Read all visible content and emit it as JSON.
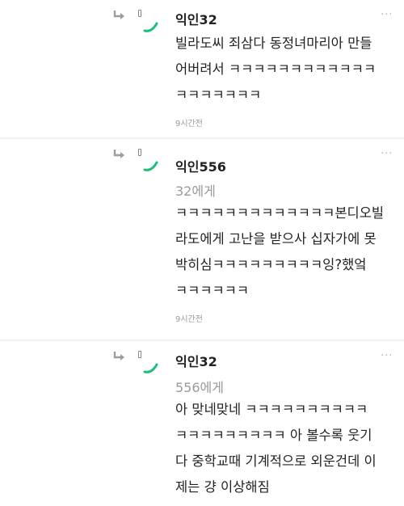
{
  "replies": [
    {
      "author": "익인32",
      "mention": "",
      "body": "빌라도씨 죄삼다 동정녀마리아 만들\n어버려서 ㅋㅋㅋㅋㅋㅋㅋㅋㅋㅋㅋㅋ\nㅋㅋㅋㅋㅋㅋㅋ",
      "time": "9시간전",
      "more": "···"
    },
    {
      "author": "익인556",
      "mention": "32에게",
      "body": "ㅋㅋㅋㅋㅋㅋㅋㅋㅋㅋㅋㅋㅋ본디오빌\n라도에게 고난을 받으사 십자가에 못\n박히심ㅋㅋㅋㅋㅋㅋㅋㅋㅋ잉?했엌\nㅋㅋㅋㅋㅋㅋ",
      "time": "9시간전",
      "more": "···"
    },
    {
      "author": "익인32",
      "mention": "556에게",
      "body": "아 맞네맞네 ㅋㅋㅋㅋㅋㅋㅋㅋㅋㅋ\nㅋㅋㅋㅋㅋㅋㅋㅋㅋ 아 볼수록 웃기\n다 중학교때 기계적으로 외운건데 이\n제는 걍 이상해짐",
      "time": "",
      "more": "···"
    }
  ],
  "colors": {
    "avatar_accent": "#1fbf7a",
    "reply_arrow": "#9c9c9c",
    "meta_text": "#9a9a9a"
  },
  "icons": {
    "reply_arrow": "reply-arrow-icon",
    "avatar": "avatar-icon",
    "more": "more-options-icon"
  }
}
